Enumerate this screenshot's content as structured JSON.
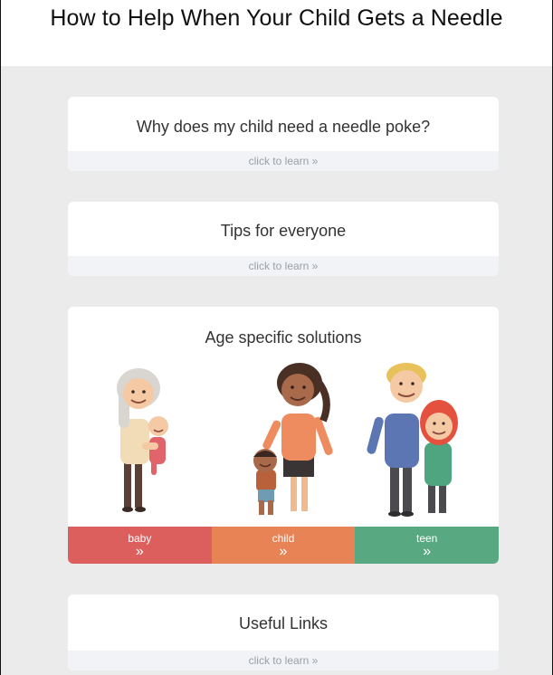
{
  "header": {
    "title": "How to Help When Your Child Gets a Needle"
  },
  "cards": {
    "why": {
      "title": "Why does my child need a needle poke?",
      "footer": "click to learn »"
    },
    "tips": {
      "title": "Tips for everyone",
      "footer": "click to learn »"
    },
    "age": {
      "title": "Age specific solutions",
      "buttons": [
        {
          "label": "baby",
          "chevron": "»"
        },
        {
          "label": "child",
          "chevron": "»"
        },
        {
          "label": "teen",
          "chevron": "»"
        }
      ]
    },
    "links": {
      "title": "Useful Links",
      "footer": "click to learn »"
    }
  },
  "colors": {
    "baby": "#dd5f5d",
    "child": "#e88356",
    "teen": "#58a881",
    "background": "#ebebeb",
    "footer_text": "#9aa0a8"
  },
  "icons": {
    "chevron": "double-chevron-right-icon"
  }
}
